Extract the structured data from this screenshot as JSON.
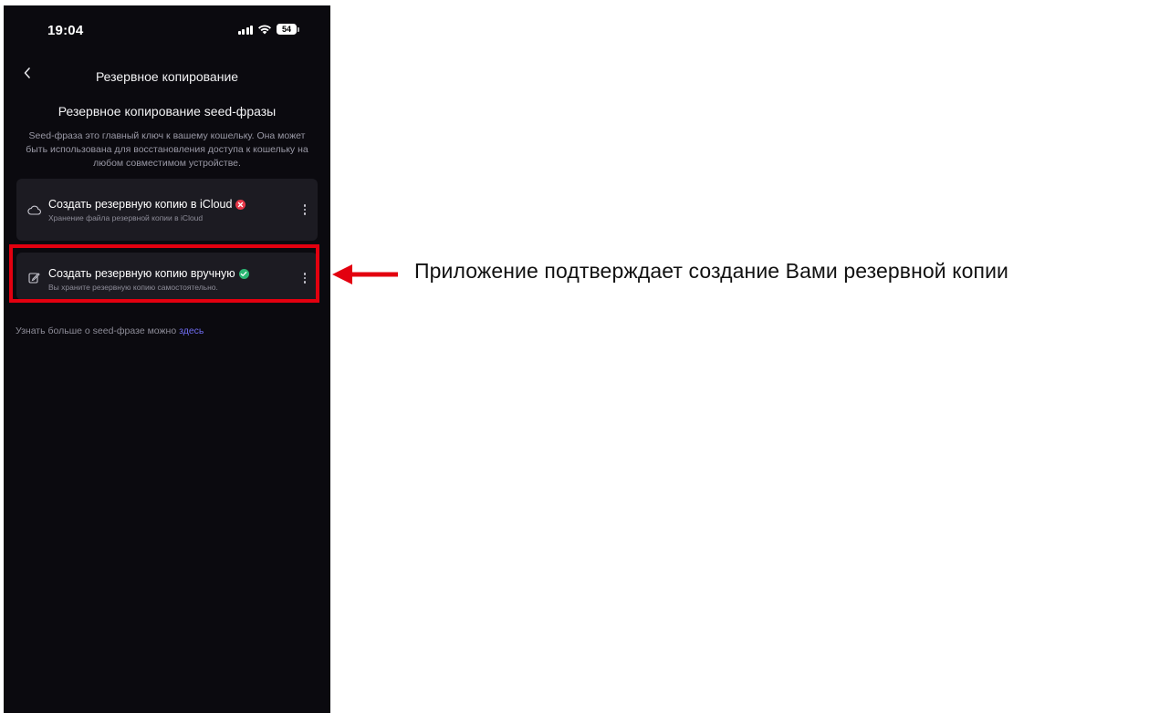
{
  "status_bar": {
    "time": "19:04",
    "battery": "54"
  },
  "nav": {
    "title": "Резервное копирование"
  },
  "section": {
    "title": "Резервное копирование seed-фразы",
    "description": "Seed-фраза это главный ключ к вашему кошельку. Она может быть использована для восстановления доступа к кошельку на любом совместимом устройстве."
  },
  "options": [
    {
      "title": "Создать резервную копию в iCloud",
      "subtitle": "Хранение файла резервной копии в iCloud",
      "icon": "cloud-icon",
      "status": "error",
      "status_color": "#e8394a"
    },
    {
      "title": "Создать резервную копию вручную",
      "subtitle": "Вы храните резервную копию самостоятельно.",
      "icon": "edit-icon",
      "status": "ok",
      "status_color": "#2bb673"
    }
  ],
  "footer": {
    "text": "Узнать больше о seed-фразе можно ",
    "link": "здесь",
    "link_color": "#6f6cf0"
  },
  "annotation": {
    "text": "Приложение подтверждает создание Вами резервной копии",
    "color": "#e3000f"
  }
}
